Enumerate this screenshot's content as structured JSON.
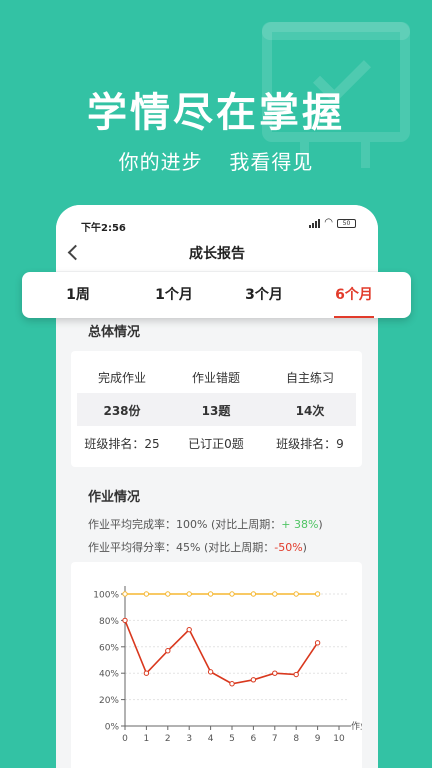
{
  "hero": {
    "title": "学情尽在掌握",
    "subtitle": "你的进步  我看得见"
  },
  "status_bar": {
    "time": "下午2:56",
    "battery": "50"
  },
  "nav": {
    "title": "成长报告"
  },
  "tabs": [
    {
      "label": "1周",
      "active": false
    },
    {
      "label": "1个月",
      "active": false
    },
    {
      "label": "3个月",
      "active": false
    },
    {
      "label": "6个月",
      "active": true
    }
  ],
  "overall": {
    "title": "总体情况",
    "columns": [
      {
        "label": "完成作业",
        "value": "238份",
        "footer": "班级排名：25"
      },
      {
        "label": "作业错题",
        "value": "13题",
        "footer": "已订正0题"
      },
      {
        "label": "自主练习",
        "value": "14次",
        "footer": "班级排名：9"
      }
    ]
  },
  "homework": {
    "title": "作业情况",
    "completion_prefix": "作业平均完成率：100%  (对比上周期：",
    "completion_change": "+ 38%",
    "completion_suffix": ")",
    "score_prefix": "作业平均得分率：45%  (对比上周期：",
    "score_change": "-50%",
    "score_suffix": ")"
  },
  "colors": {
    "brand": "#33c2a4",
    "accent_red": "#e23b2b",
    "positive_green": "#4fc464",
    "series_orange": "#f5b731",
    "series_red": "#d9381e"
  },
  "chart_data": {
    "type": "line",
    "xlabel": "作业",
    "ylabel": "",
    "x_ticks": [
      "0",
      "1",
      "2",
      "3",
      "4",
      "5",
      "6",
      "7",
      "8",
      "9",
      "10"
    ],
    "y_ticks": [
      "0%",
      "20%",
      "40%",
      "60%",
      "80%",
      "100%"
    ],
    "ylim": [
      0,
      100
    ],
    "xlim": [
      0,
      10
    ],
    "grid": true,
    "series": [
      {
        "color": "#f5b731",
        "x": [
          0,
          1,
          2,
          3,
          4,
          5,
          6,
          7,
          8,
          9
        ],
        "values": [
          100,
          100,
          100,
          100,
          100,
          100,
          100,
          100,
          100,
          100
        ]
      },
      {
        "color": "#d9381e",
        "x": [
          0,
          1,
          2,
          3,
          4,
          5,
          6,
          7,
          8,
          9
        ],
        "values": [
          80,
          40,
          57,
          73,
          41,
          32,
          35,
          40,
          39,
          63
        ]
      }
    ]
  }
}
